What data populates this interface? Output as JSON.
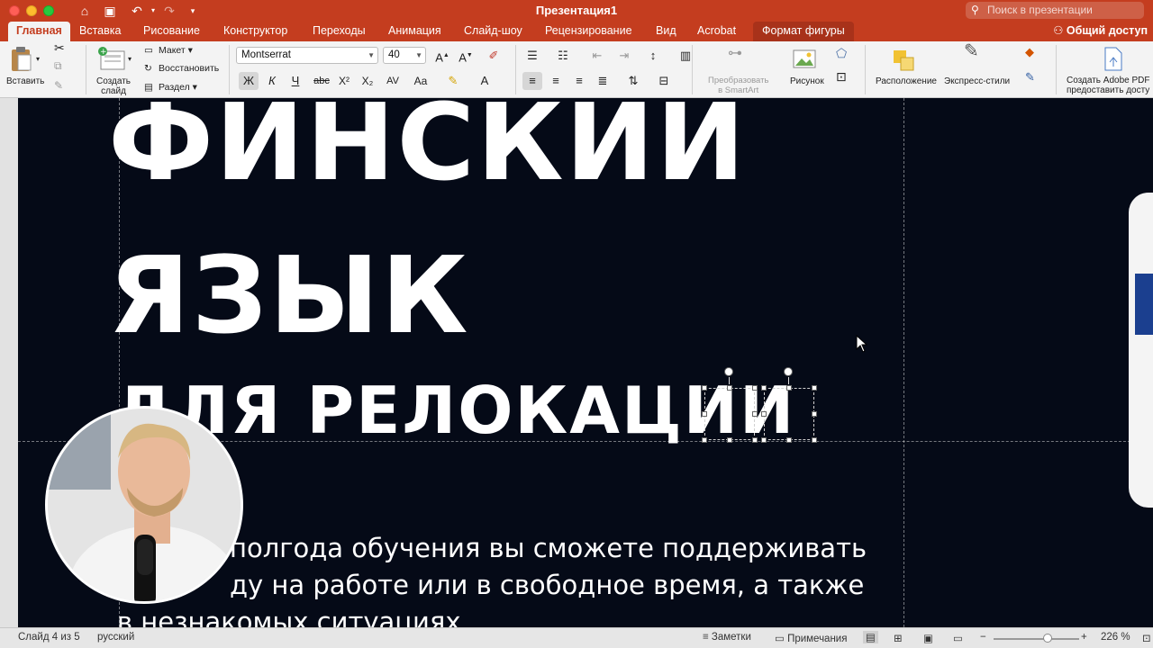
{
  "window": {
    "title": "Презентация1",
    "search_placeholder": "Поиск в презентации",
    "share_label": "Общий доступ"
  },
  "tabs": [
    "Главная",
    "Вставка",
    "Рисование",
    "Конструктор",
    "Переходы",
    "Анимация",
    "Слайд-шоу",
    "Рецензирование",
    "Вид",
    "Acrobat",
    "Формат фигуры"
  ],
  "ribbon": {
    "paste_label": "Вставить",
    "new_slide_label": "Создать слайд",
    "new_slide_line1": "Создать",
    "new_slide_line2": "слайд",
    "layout_label": "Макет",
    "reset_label": "Восстановить",
    "section_label": "Раздел",
    "font_name": "Montserrat",
    "font_size": "40",
    "bold_glyph": "Ж",
    "italic_glyph": "К",
    "underline_glyph": "Ч",
    "strike_glyph": "abc",
    "superscript_glyph": "X²",
    "subscript_glyph": "X₂",
    "smartart_line1": "Преобразовать",
    "smartart_line2": "в SmartArt",
    "picture_label": "Рисунок",
    "arrange_label": "Расположение",
    "quick_styles_label": "Экспресс-стили",
    "adobe_line1": "Создать Adobe PDF",
    "adobe_line2": "предоставить досту"
  },
  "slide": {
    "heading_line1": "ФИНСКИЙ",
    "heading_line2": "ЯЗЫК",
    "heading_line3": "ДЛЯ РЕЛОКАЦИИ",
    "body_line1": "полгода обучения вы сможете поддерживать",
    "body_line2": "ду на работе или в свободное время, а также",
    "body_line3": "в незнакомых ситуациях."
  },
  "status": {
    "slide_counter": "Слайд 4 из 5",
    "language": "русский",
    "notes_label": "Заметки",
    "comments_label": "Примечания",
    "zoom": "226 %"
  },
  "colors": {
    "accent": "#c43d1f",
    "slide_bg": "#050a17",
    "flag_blue": "#1b3f8f"
  }
}
